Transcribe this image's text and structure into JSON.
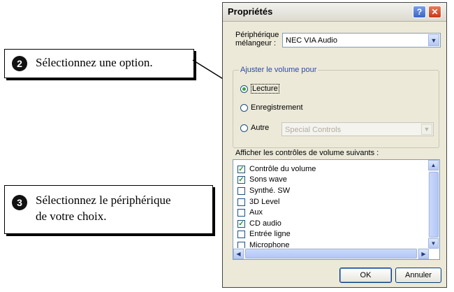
{
  "callouts": [
    {
      "number": "2",
      "text": "Sélectionnez une option."
    },
    {
      "number": "3",
      "text_line1": "Sélectionnez le périphérique",
      "text_line2": "de votre choix."
    }
  ],
  "dialog": {
    "title": "Propriétés",
    "help_glyph": "?",
    "close_glyph": "✕",
    "mixer_label_line1": "Périphérique",
    "mixer_label_line2": "mélangeur :",
    "mixer_value": "NEC VIA Audio",
    "group_label": "Ajuster le volume pour",
    "radios": [
      {
        "label": "Lecture",
        "checked": true
      },
      {
        "label": "Enregistrement",
        "checked": false
      },
      {
        "label": "Autre",
        "checked": false
      }
    ],
    "other_value": "Special Controls",
    "list_label": "Afficher les contrôles de volume suivants :",
    "list_items": [
      {
        "label": "Contrôle du volume",
        "checked": true
      },
      {
        "label": "Sons wave",
        "checked": true
      },
      {
        "label": "Synthé. SW",
        "checked": false
      },
      {
        "label": "3D Level",
        "checked": false
      },
      {
        "label": "Aux",
        "checked": false
      },
      {
        "label": "CD audio",
        "checked": true
      },
      {
        "label": "Entrée ligne",
        "checked": false
      },
      {
        "label": "Microphone",
        "checked": false
      }
    ],
    "ok_label": "OK",
    "cancel_label": "Annuler"
  }
}
